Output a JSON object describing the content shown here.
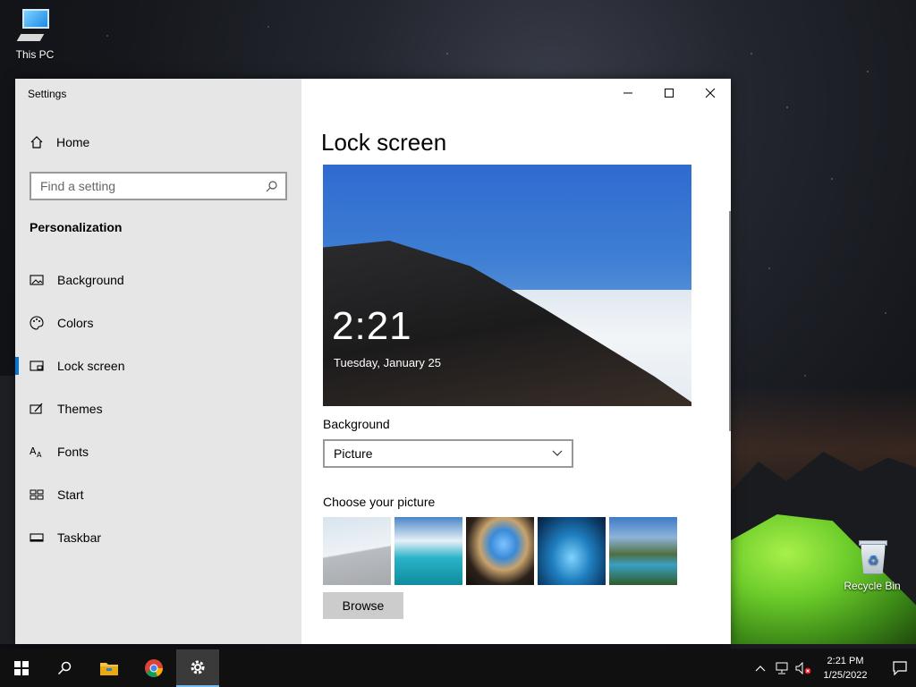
{
  "desktop": {
    "icons": [
      {
        "label": "This PC"
      },
      {
        "label": "Recycle Bin"
      }
    ]
  },
  "window": {
    "title": "Settings",
    "controls": {
      "minimize": "minimize-icon",
      "maximize": "maximize-icon",
      "close": "close-icon"
    }
  },
  "sidebar": {
    "home_label": "Home",
    "search_placeholder": "Find a setting",
    "section_title": "Personalization",
    "items": [
      {
        "label": "Background",
        "icon": "picture-icon",
        "active": false
      },
      {
        "label": "Colors",
        "icon": "palette-icon",
        "active": false
      },
      {
        "label": "Lock screen",
        "icon": "lock-screen-icon",
        "active": true
      },
      {
        "label": "Themes",
        "icon": "themes-icon",
        "active": false
      },
      {
        "label": "Fonts",
        "icon": "fonts-icon",
        "active": false
      },
      {
        "label": "Start",
        "icon": "start-icon",
        "active": false
      },
      {
        "label": "Taskbar",
        "icon": "taskbar-icon",
        "active": false
      }
    ]
  },
  "main": {
    "page_title": "Lock screen",
    "preview": {
      "time": "2:21",
      "date": "Tuesday, January 25"
    },
    "background_label": "Background",
    "background_select": "Picture",
    "choose_picture_label": "Choose your picture",
    "browse_label": "Browse"
  },
  "taskbar": {
    "apps": [
      "start-icon",
      "search-icon",
      "file-explorer-icon",
      "chrome-icon",
      "settings-icon"
    ],
    "clock_time": "2:21 PM",
    "clock_date": "1/25/2022"
  },
  "colors": {
    "accent": "#0078d7",
    "sidebar_bg": "#e6e6e6",
    "taskbar_bg": "#101010"
  }
}
